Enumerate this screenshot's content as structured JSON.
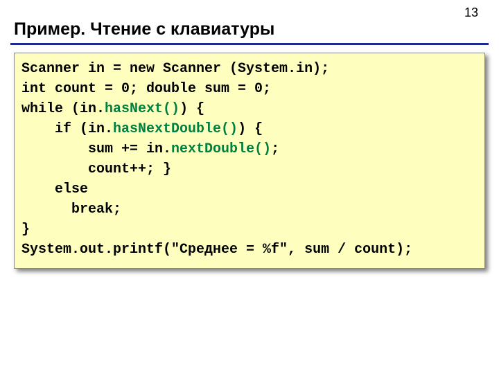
{
  "pageNumber": "13",
  "title": "Пример. Чтение с клавиатуры",
  "code": {
    "l1": "Scanner in = new Scanner (System.in);",
    "l2": "int count = 0; double sum = 0;",
    "l3a": "while (in.",
    "l3b": "hasNext()",
    "l3c": ") {",
    "l4a": "    if (in.",
    "l4b": "hasNextDouble()",
    "l4c": ") {",
    "l5a": "        sum += in.",
    "l5b": "nextDouble()",
    "l5c": ";",
    "l6": "        count++; }",
    "l7": "    else",
    "l8": "      break;",
    "l9": "}",
    "l10": "System.out.printf(\"Среднее = %f\", sum / count);"
  }
}
